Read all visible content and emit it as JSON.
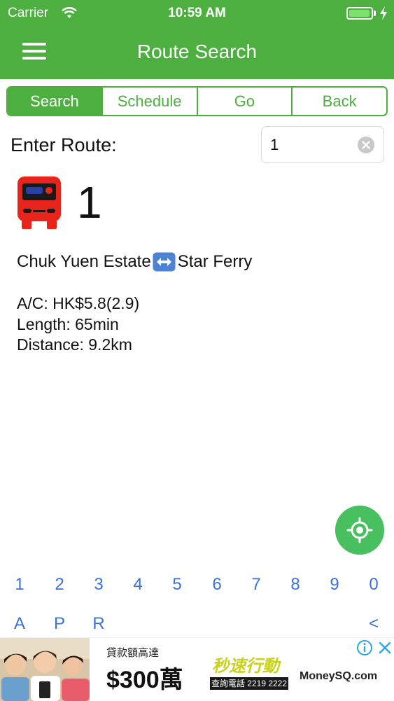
{
  "status_bar": {
    "carrier": "Carrier",
    "time": "10:59 AM",
    "battery_level": 0.95
  },
  "nav": {
    "title": "Route Search"
  },
  "tabs": [
    {
      "label": "Search",
      "active": true
    },
    {
      "label": "Schedule",
      "active": false
    },
    {
      "label": "Go",
      "active": false
    },
    {
      "label": "Back",
      "active": false
    }
  ],
  "search": {
    "label": "Enter Route:",
    "value": "1"
  },
  "route": {
    "number": "1",
    "origin": "Chuk Yuen Estate",
    "destination": "Star Ferry",
    "fare": "A/C: HK$5.8(2.9)",
    "length": "Length: 65min",
    "distance": "Distance: 9.2km"
  },
  "keypad": {
    "digits": [
      "1",
      "2",
      "3",
      "4",
      "5",
      "6",
      "7",
      "8",
      "9",
      "0"
    ],
    "letters": [
      "A",
      "P",
      "R"
    ],
    "backspace": "<"
  },
  "ad": {
    "line1": "貸款額高達",
    "amount": "$300萬",
    "slogan": "秒速行動",
    "phone": "查詢電話 2219 2222",
    "brand": "MoneySQ.com"
  },
  "colors": {
    "primary": "#4caf3f",
    "key_blue": "#3a73d8",
    "locate_green": "#48c060",
    "bus_red": "#e8241c"
  }
}
